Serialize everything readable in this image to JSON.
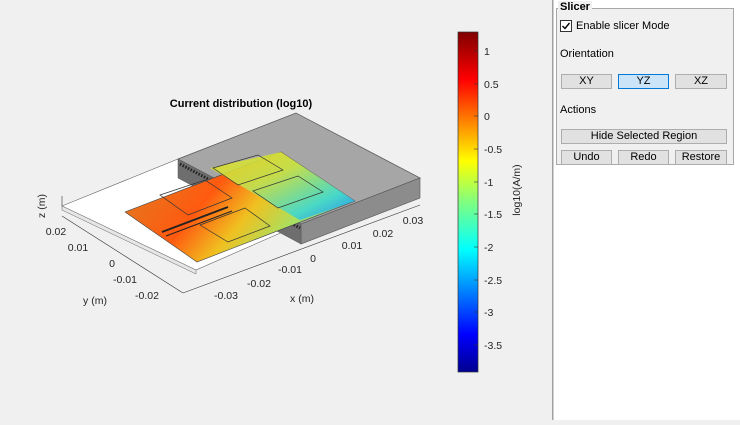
{
  "plot": {
    "title": "Current distribution (log10)",
    "xlabel": "x (m)",
    "ylabel": "y (m)",
    "zlabel": "z (m)",
    "x_ticks": [
      "-0.03",
      "-0.02",
      "-0.01",
      "0",
      "0.01",
      "0.02",
      "0.03"
    ],
    "y_ticks": [
      "-0.02",
      "-0.01",
      "0",
      "0.01",
      "0.02"
    ]
  },
  "colorbar": {
    "label": "log10(A/m)",
    "ticks": [
      "1",
      "0.5",
      "0",
      "-0.5",
      "-1",
      "-1.5",
      "-2",
      "-2.5",
      "-3",
      "-3.5"
    ],
    "range": [
      -4,
      1.3
    ]
  },
  "slicer": {
    "title": "Slicer",
    "enable_label": "Enable slicer Mode",
    "enable_checked": true,
    "orientation_label": "Orientation",
    "orientation_options": [
      "XY",
      "YZ",
      "XZ"
    ],
    "orientation_selected": "YZ",
    "actions_label": "Actions",
    "hide_label": "Hide Selected Region",
    "undo_label": "Undo",
    "redo_label": "Redo",
    "restore_label": "Restore"
  },
  "colors": {
    "selected_button": "#cce4f7",
    "selected_border": "#0078d7",
    "substrate_slice": "#a6a6a6"
  }
}
